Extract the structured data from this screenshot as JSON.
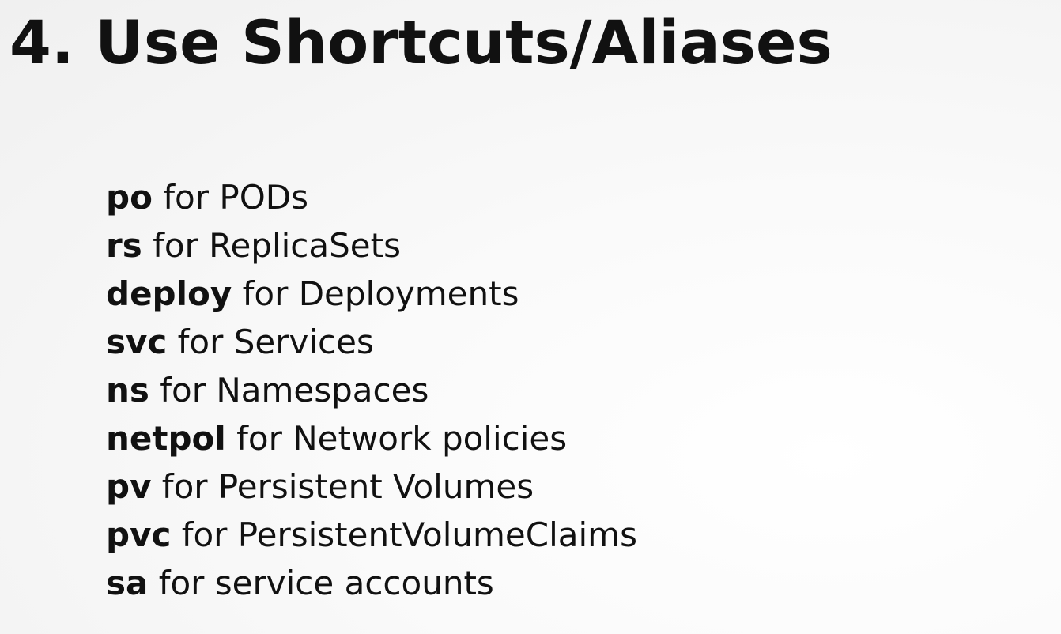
{
  "slide": {
    "title": "4. Use Shortcuts/Aliases",
    "aliases": [
      {
        "short": "po",
        "description": " for PODs"
      },
      {
        "short": "rs",
        "description": " for ReplicaSets"
      },
      {
        "short": "deploy",
        "description": " for Deployments"
      },
      {
        "short": "svc",
        "description": " for Services"
      },
      {
        "short": "ns",
        "description": " for Namespaces"
      },
      {
        "short": "netpol",
        "description": " for Network policies"
      },
      {
        "short": "pv",
        "description": " for Persistent Volumes"
      },
      {
        "short": "pvc",
        "description": " for PersistentVolumeClaims"
      },
      {
        "short": "sa",
        "description": " for service accounts"
      }
    ]
  }
}
